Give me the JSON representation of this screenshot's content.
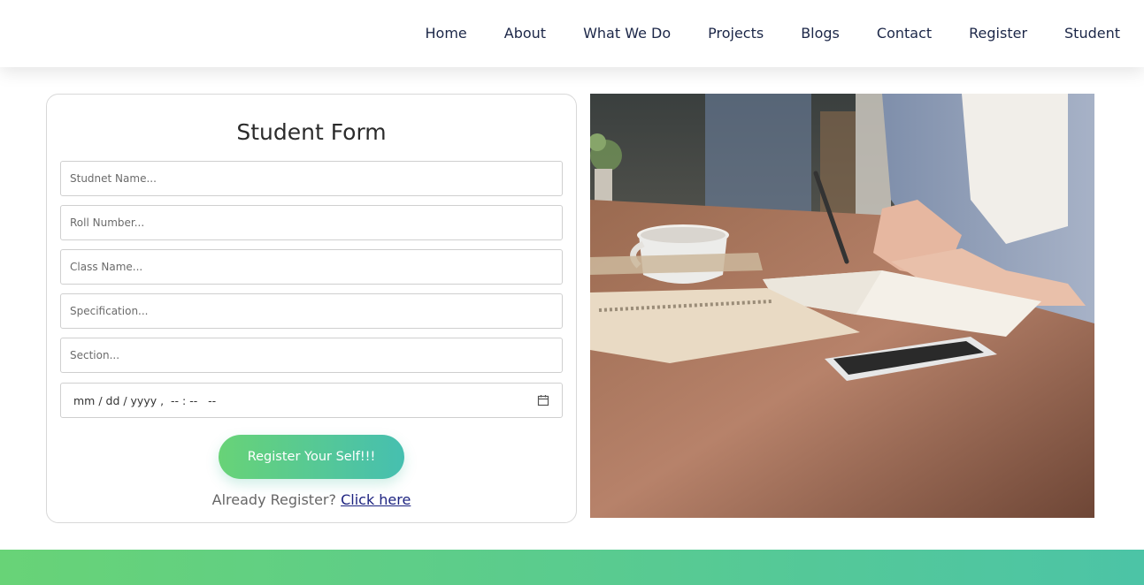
{
  "nav": {
    "items": [
      {
        "label": "Home"
      },
      {
        "label": "About"
      },
      {
        "label": "What We Do"
      },
      {
        "label": "Projects"
      },
      {
        "label": "Blogs"
      },
      {
        "label": "Contact"
      },
      {
        "label": "Register"
      },
      {
        "label": "Student"
      }
    ]
  },
  "form": {
    "title": "Student Form",
    "fields": {
      "student_name": {
        "placeholder": "Studnet Name..."
      },
      "roll_number": {
        "placeholder": "Roll Number..."
      },
      "class_name": {
        "placeholder": "Class Name..."
      },
      "specification": {
        "placeholder": "Specification..."
      },
      "section": {
        "placeholder": "Section..."
      },
      "datetime": {
        "value": "mm / dd / yyyy ,  -- : --   --"
      }
    },
    "submit_label": "Register Your Self!!!",
    "already_text": "Already Register?",
    "link_text": "Click here"
  },
  "colors": {
    "accent_start": "#68d377",
    "accent_end": "#46bfb0",
    "nav_text": "#1c2748",
    "link": "#1c2380"
  },
  "image": {
    "subject": "person writing in notebook at wooden desk with coffee cup and phone"
  }
}
